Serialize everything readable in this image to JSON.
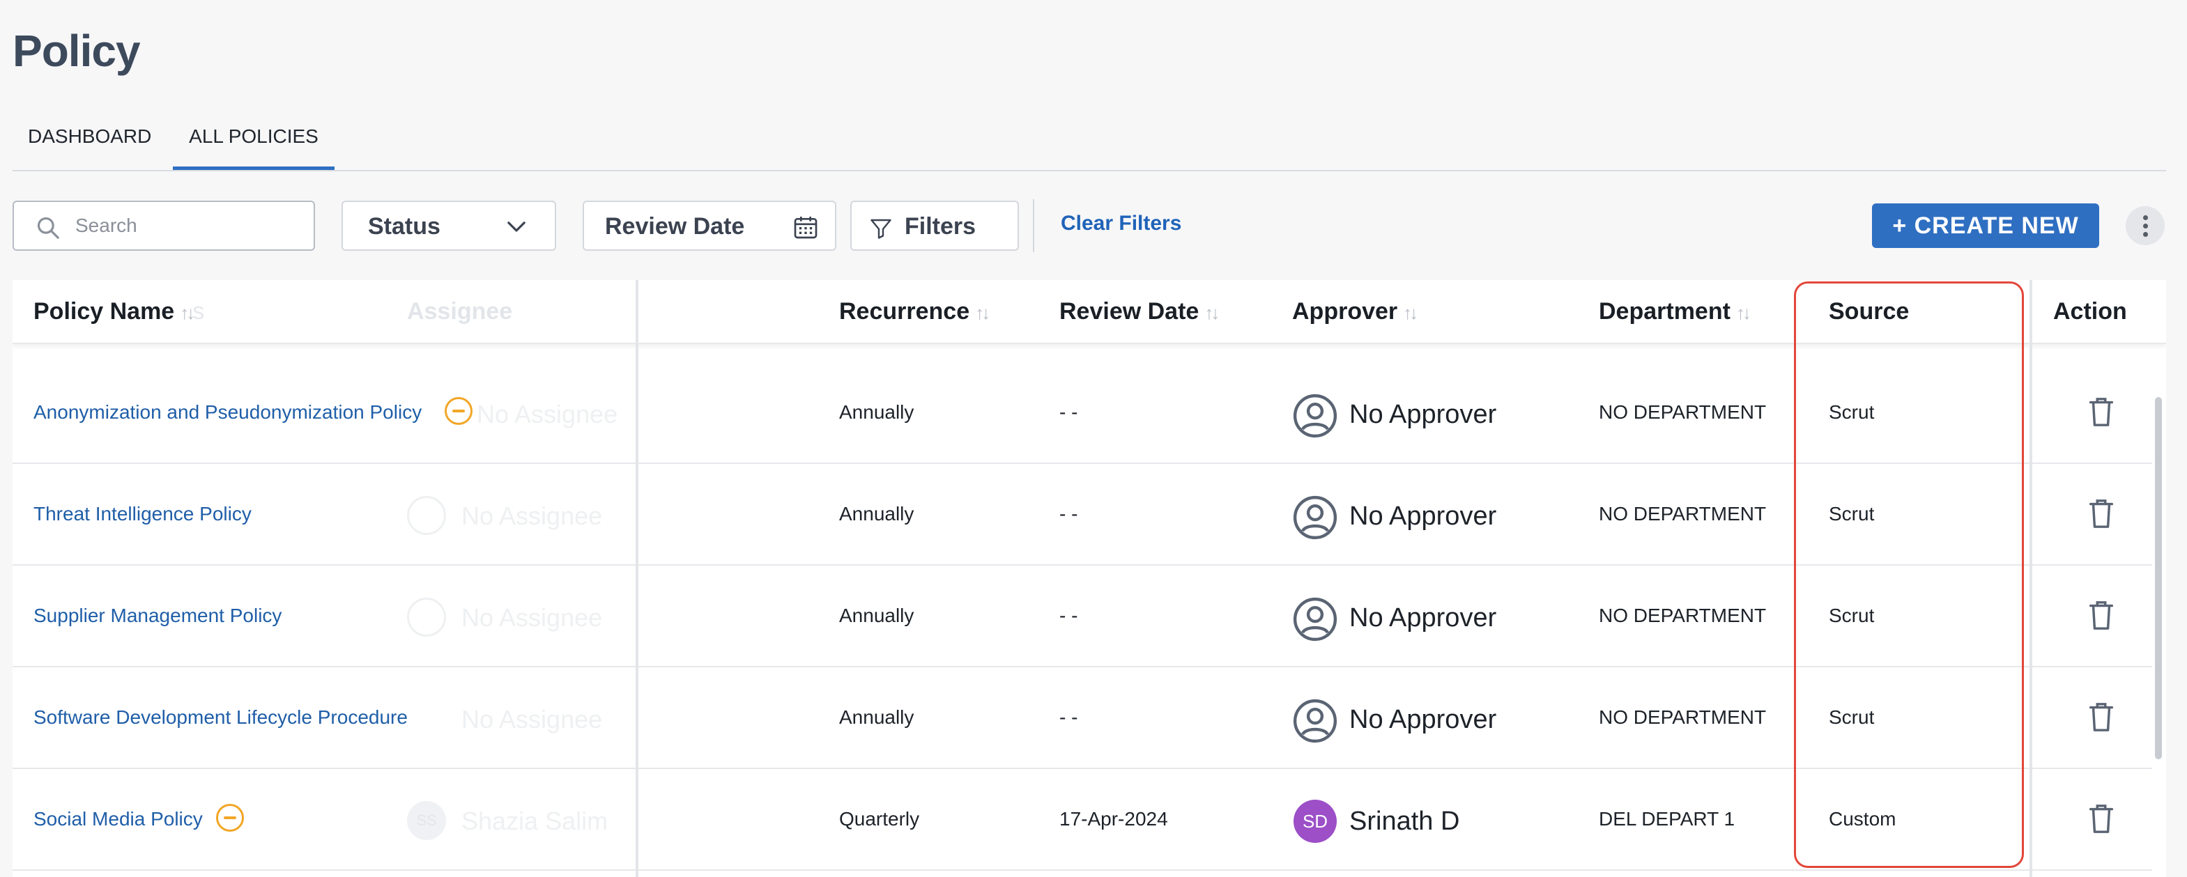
{
  "page": {
    "title": "Policy"
  },
  "tabs": [
    {
      "label": "DASHBOARD",
      "active": false
    },
    {
      "label": "ALL POLICIES",
      "active": true
    }
  ],
  "toolbar": {
    "search_placeholder": "Search",
    "status_label": "Status",
    "review_date_label": "Review Date",
    "filters_label": "Filters",
    "clear_filters_label": "Clear Filters",
    "create_new_label": "+ CREATE NEW"
  },
  "table": {
    "columns": {
      "policy_name": "Policy Name",
      "status_ghost": "s",
      "assignee": "Assignee",
      "recurrence": "Recurrence",
      "review_date": "Review Date",
      "approver": "Approver",
      "department": "Department",
      "source": "Source",
      "action": "Action"
    },
    "rows": [
      {
        "name": "Anonymization and Pseudonymization Policy",
        "has_status_icon": true,
        "assignee": "No Assignee",
        "recurrence": "Annually",
        "review_date": "- -",
        "approver": "No Approver",
        "department": "NO DEPARTMENT",
        "source": "Scrut"
      },
      {
        "name": "Threat Intelligence Policy",
        "has_status_icon": false,
        "assignee": "No Assignee",
        "recurrence": "Annually",
        "review_date": "- -",
        "approver": "No Approver",
        "department": "NO DEPARTMENT",
        "source": "Scrut"
      },
      {
        "name": "Supplier Management Policy",
        "has_status_icon": false,
        "assignee": "No Assignee",
        "recurrence": "Annually",
        "review_date": "- -",
        "approver": "No Approver",
        "department": "NO DEPARTMENT",
        "source": "Scrut"
      },
      {
        "name": "Software Development Lifecycle Procedure",
        "has_status_icon": false,
        "assignee": "No Assignee",
        "recurrence": "Annually",
        "review_date": "- -",
        "approver": "No Approver",
        "department": "NO DEPARTMENT",
        "source": "Scrut"
      },
      {
        "name": "Social Media Policy",
        "has_status_icon": true,
        "assignee": "Shazia Salim",
        "assignee_initials": "SS",
        "recurrence": "Quarterly",
        "review_date": "17-Apr-2024",
        "approver": "Srinath D",
        "approver_initials": "SD",
        "department": "DEL DEPART 1",
        "source": "Custom"
      }
    ]
  },
  "colors": {
    "primary": "#2f6fc2",
    "link": "#1f5ea8",
    "status_pending": "#f2a626",
    "avatar_sd": "#9c4fc7",
    "highlight": "#e2473a"
  },
  "icons": [
    "search-icon",
    "chevron-down-icon",
    "calendar-icon",
    "filter-icon",
    "more-vertical-icon",
    "sort-icon",
    "user-circle-icon",
    "trash-icon",
    "status-minus-icon"
  ]
}
